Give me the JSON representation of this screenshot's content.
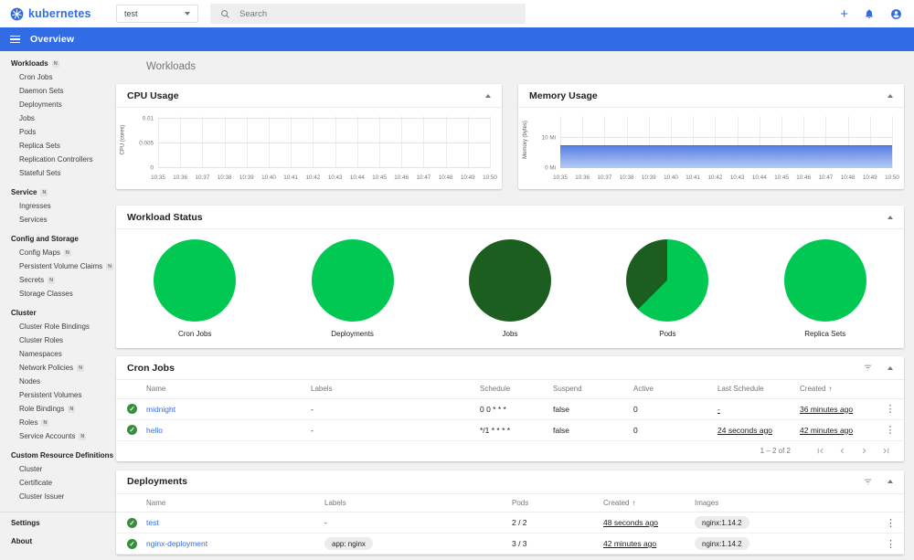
{
  "header": {
    "brand": "kubernetes",
    "namespace": "test",
    "search_placeholder": "Search",
    "actions": [
      "add-resource",
      "notifications",
      "user-account"
    ]
  },
  "toolbar": {
    "title": "Overview"
  },
  "page_title": "Workloads",
  "colors": {
    "brand_blue": "#326ce5",
    "link_blue": "#326de6",
    "success_green": "#00c853",
    "dark_green": "#1b5e20",
    "check_green": "#388e3c"
  },
  "sidebar": {
    "badge_text": "N",
    "groups": [
      {
        "label": "Workloads",
        "badge": true,
        "items": [
          {
            "label": "Cron Jobs"
          },
          {
            "label": "Daemon Sets"
          },
          {
            "label": "Deployments"
          },
          {
            "label": "Jobs"
          },
          {
            "label": "Pods"
          },
          {
            "label": "Replica Sets"
          },
          {
            "label": "Replication Controllers"
          },
          {
            "label": "Stateful Sets"
          }
        ]
      },
      {
        "label": "Service",
        "badge": true,
        "items": [
          {
            "label": "Ingresses"
          },
          {
            "label": "Services"
          }
        ]
      },
      {
        "label": "Config and Storage",
        "badge": false,
        "items": [
          {
            "label": "Config Maps",
            "badge": true
          },
          {
            "label": "Persistent Volume Claims",
            "badge": true
          },
          {
            "label": "Secrets",
            "badge": true
          },
          {
            "label": "Storage Classes"
          }
        ]
      },
      {
        "label": "Cluster",
        "badge": false,
        "items": [
          {
            "label": "Cluster Role Bindings"
          },
          {
            "label": "Cluster Roles"
          },
          {
            "label": "Namespaces"
          },
          {
            "label": "Network Policies",
            "badge": true
          },
          {
            "label": "Nodes"
          },
          {
            "label": "Persistent Volumes"
          },
          {
            "label": "Role Bindings",
            "badge": true
          },
          {
            "label": "Roles",
            "badge": true
          },
          {
            "label": "Service Accounts",
            "badge": true
          }
        ]
      },
      {
        "label": "Custom Resource Definitions",
        "badge": false,
        "items": [
          {
            "label": "Cluster"
          },
          {
            "label": "Certificate"
          },
          {
            "label": "Cluster Issuer"
          }
        ]
      }
    ],
    "footer_items": [
      {
        "label": "Settings"
      },
      {
        "label": "About"
      }
    ]
  },
  "chart_data": {
    "cpu": {
      "type": "line",
      "title": "CPU Usage",
      "ylabel": "CPU (cores)",
      "ylim": [
        0,
        0.01
      ],
      "yticks": [
        {
          "label": "0",
          "pct": 0
        },
        {
          "label": "0.005",
          "pct": 47
        },
        {
          "label": "0.01",
          "pct": 94
        }
      ],
      "xticks": [
        "10:35",
        "10:36",
        "10:37",
        "10:38",
        "10:39",
        "10:40",
        "10:41",
        "10:42",
        "10:43",
        "10:44",
        "10:45",
        "10:46",
        "10:47",
        "10:48",
        "10:49",
        "10:50"
      ],
      "series": []
    },
    "memory": {
      "type": "area",
      "title": "Memory Usage",
      "ylabel": "Memory (bytes)",
      "yticks": [
        {
          "label": "0 Mi",
          "pct": 0
        },
        {
          "label": "10 Mi",
          "pct": 58
        }
      ],
      "xticks": [
        "10:35",
        "10:36",
        "10:37",
        "10:38",
        "10:39",
        "10:40",
        "10:41",
        "10:42",
        "10:43",
        "10:44",
        "10:45",
        "10:46",
        "10:47",
        "10:48",
        "10:49",
        "10:50"
      ],
      "series": [
        {
          "name": "memory usage",
          "constant_value_mi": 7.5
        }
      ],
      "area_pct": 44
    },
    "workload_status": {
      "type": "pie",
      "title": "Workload Status",
      "pies": [
        {
          "label": "Cron Jobs",
          "slices": [
            {
              "name": "succeeded",
              "color": "#00c853",
              "pct": 100
            }
          ]
        },
        {
          "label": "Deployments",
          "slices": [
            {
              "name": "running",
              "color": "#00c853",
              "pct": 100
            }
          ]
        },
        {
          "label": "Jobs",
          "slices": [
            {
              "name": "succeeded",
              "color": "#1b5e20",
              "pct": 100
            }
          ]
        },
        {
          "label": "Pods",
          "slices": [
            {
              "name": "running",
              "color": "#00c853",
              "pct": 62.5
            },
            {
              "name": "succeeded",
              "color": "#1b5e20",
              "pct": 37.5
            }
          ]
        },
        {
          "label": "Replica Sets",
          "slices": [
            {
              "name": "running",
              "color": "#00c853",
              "pct": 100
            }
          ]
        }
      ]
    }
  },
  "tables": {
    "cron_jobs": {
      "title": "Cron Jobs",
      "columns": [
        "Name",
        "Labels",
        "Schedule",
        "Suspend",
        "Active",
        "Last Schedule",
        "Created"
      ],
      "sort_column": "Created",
      "rows": [
        {
          "name": "midnight",
          "labels": "-",
          "schedule": "0 0 * * *",
          "suspend": "false",
          "active": "0",
          "last_schedule": "-",
          "created": "36 minutes ago"
        },
        {
          "name": "hello",
          "labels": "-",
          "schedule": "*/1 * * * *",
          "suspend": "false",
          "active": "0",
          "last_schedule": "24 seconds ago",
          "created": "42 minutes ago"
        }
      ],
      "pagination_range": "1 – 2 of 2"
    },
    "deployments": {
      "title": "Deployments",
      "columns": [
        "Name",
        "Labels",
        "Pods",
        "Created",
        "Images"
      ],
      "sort_column": "Created",
      "rows": [
        {
          "name": "test",
          "labels": {
            "chip": false,
            "text": "-"
          },
          "pods": "2 / 2",
          "created": "48 seconds ago",
          "images": [
            {
              "chip": true,
              "text": "nginx:1.14.2"
            }
          ]
        },
        {
          "name": "nginx-deployment",
          "labels": {
            "chip": true,
            "text": "app: nginx"
          },
          "pods": "3 / 3",
          "created": "42 minutes ago",
          "images": [
            {
              "chip": true,
              "text": "nginx:1.14.2"
            }
          ]
        }
      ]
    }
  }
}
